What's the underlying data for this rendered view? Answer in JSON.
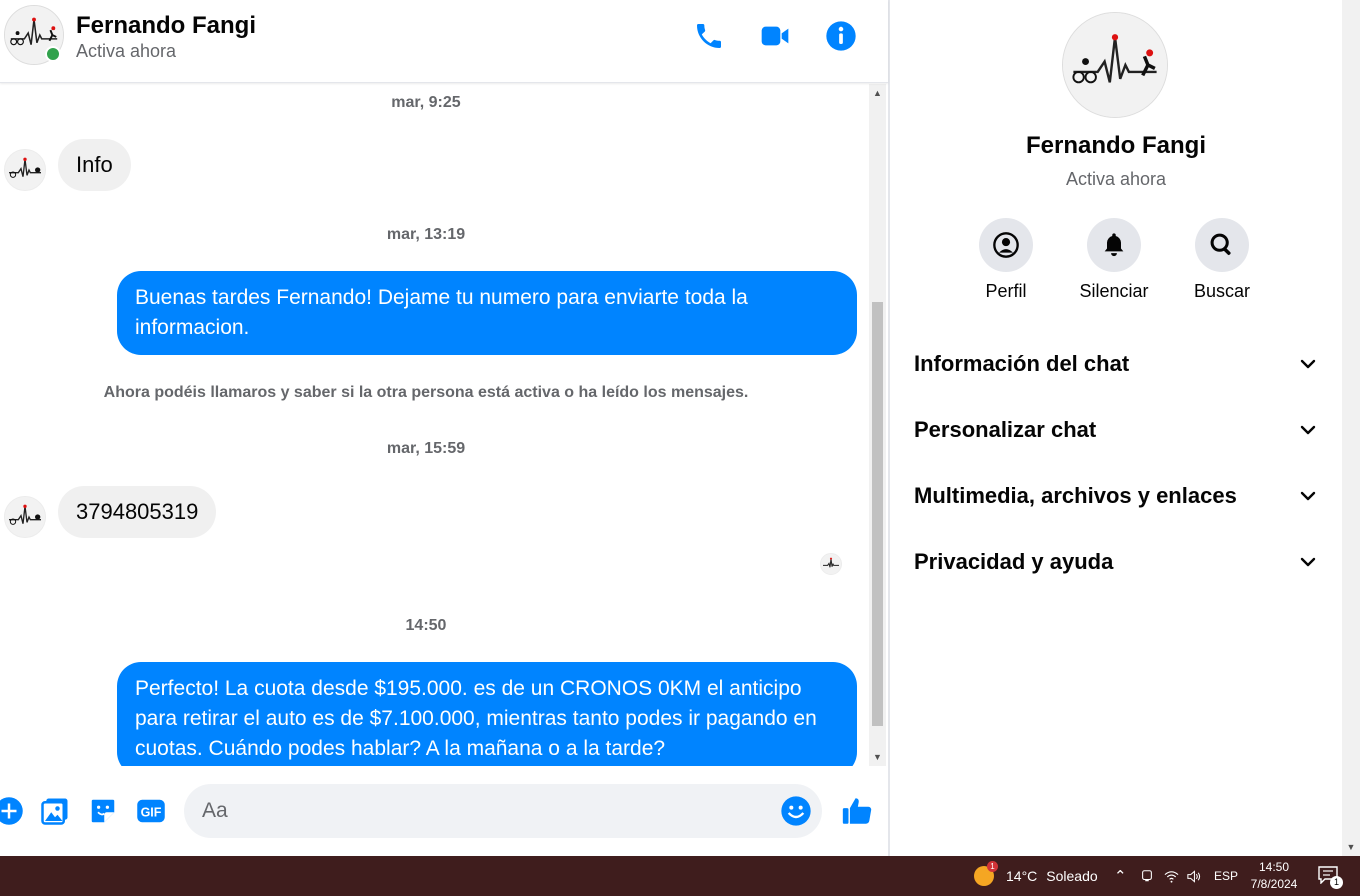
{
  "header": {
    "name": "Fernando Fangi",
    "status": "Activa ahora"
  },
  "messages": [
    {
      "type": "timestamp",
      "text": "mar, 9:25"
    },
    {
      "type": "incoming",
      "text": "Info"
    },
    {
      "type": "timestamp",
      "text": "mar, 13:19"
    },
    {
      "type": "outgoing",
      "text": "Buenas tardes Fernando! Dejame tu numero para enviarte toda la informacion."
    },
    {
      "type": "notice",
      "text": "Ahora podéis llamaros y saber si la otra persona está activa o ha leído los mensajes."
    },
    {
      "type": "timestamp",
      "text": "mar, 15:59"
    },
    {
      "type": "incoming",
      "text": "3794805319"
    },
    {
      "type": "timestamp",
      "text": "14:50"
    },
    {
      "type": "outgoing",
      "text": "Perfecto! La cuota desde $195.000. es de un CRONOS 0KM el anticipo para retirar el auto es de $7.100.000, mientras tanto podes ir pagando en cuotas. Cuándo podes hablar? A la mañana o a la tarde?"
    }
  ],
  "composer": {
    "placeholder": "Aa",
    "gif_label": "GIF"
  },
  "panel": {
    "name": "Fernando Fangi",
    "status": "Activa ahora",
    "actions": [
      {
        "label": "Perfil",
        "icon": "profile-icon"
      },
      {
        "label": "Silenciar",
        "icon": "bell-icon"
      },
      {
        "label": "Buscar",
        "icon": "search-icon"
      }
    ],
    "sections": [
      {
        "label": "Información del chat"
      },
      {
        "label": "Personalizar chat"
      },
      {
        "label": "Multimedia, archivos y enlaces"
      },
      {
        "label": "Privacidad y ayuda"
      }
    ]
  },
  "taskbar": {
    "weather_temp": "14°C",
    "weather_text": "Soleado",
    "weather_badge": "1",
    "language": "ESP",
    "time": "14:50",
    "date": "7/8/2024",
    "notification_count": "1"
  },
  "colors": {
    "accent": "#0084ff",
    "online": "#31a24c",
    "taskbar": "#3f1d1d"
  }
}
